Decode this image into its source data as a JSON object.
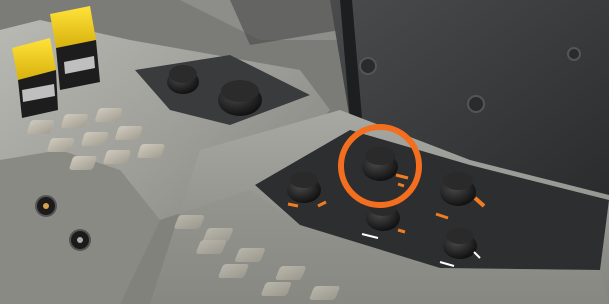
{
  "scene": {
    "subject": "tractor-armrest-control-console",
    "colors": {
      "console_body": "#9a9a95",
      "console_shadow": "#5f5f5b",
      "panel_dark": "#2d2e30",
      "lid_dark": "#3a3b3d",
      "button_face": "#b7b2a6",
      "knob_black": "#161616",
      "lever_yellow": "#f2d21a",
      "accent_orange": "#f27c22",
      "highlight_ring": "#f36f1f"
    },
    "highlight": {
      "target": "center-rotary-knob"
    }
  }
}
